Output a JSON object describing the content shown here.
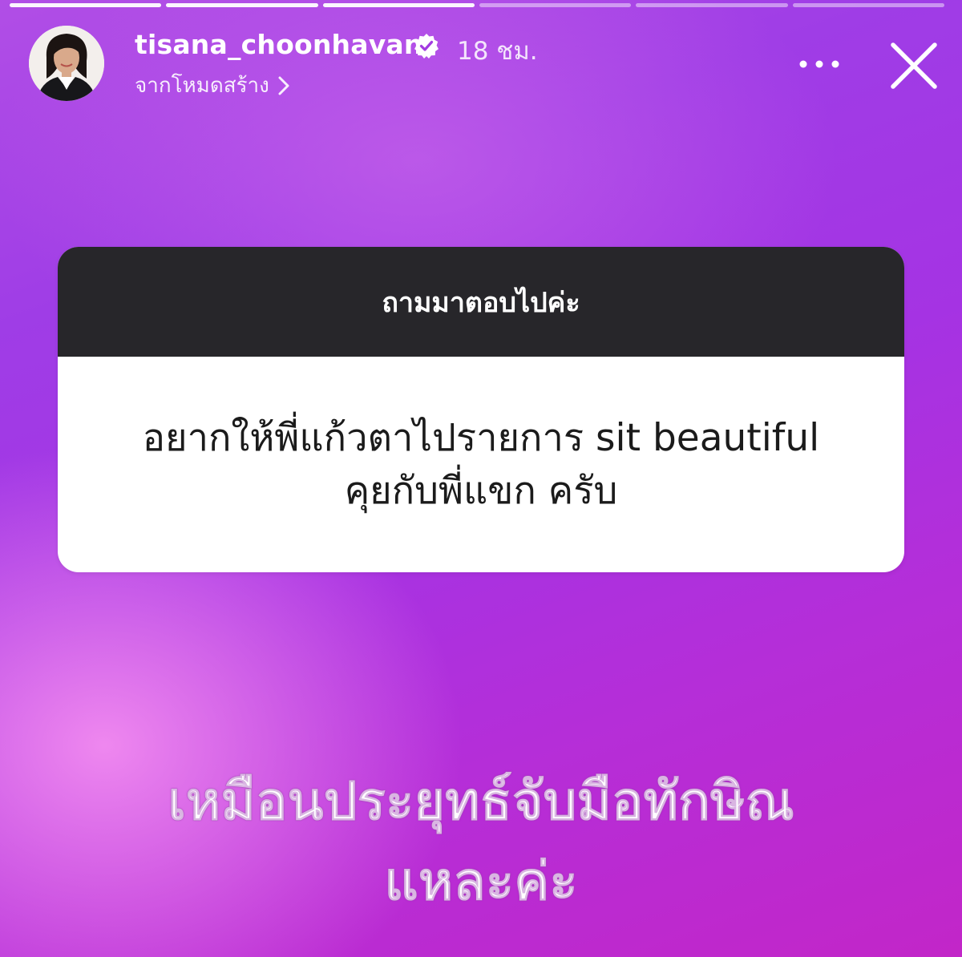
{
  "story": {
    "segments_total": 6,
    "segments_done": 3
  },
  "header": {
    "username": "tisana_choonhavan",
    "time_ago": "18 ชม.",
    "subtitle": "จากโหมดสร้าง",
    "icons": {
      "verified": "verified-badge-icon",
      "chevron": "chevron-right-icon",
      "more": "more-options-icon",
      "close": "close-icon"
    }
  },
  "question_card": {
    "title": "ถามมาตอบไปค่ะ",
    "question_line1": "อยากให้พี่แก้วตาไปรายการ sit beautiful",
    "question_line2": "คุยกับพี่แขก ครับ"
  },
  "answer": {
    "line1": "เหมือนประยุทธ์จับมือทักษิณ",
    "line2": "แหละค่ะ"
  },
  "colors": {
    "card_header_bg": "#27262a",
    "card_body_bg": "#ffffff",
    "background_start": "#f28cf0",
    "background_end": "#c226c8"
  }
}
